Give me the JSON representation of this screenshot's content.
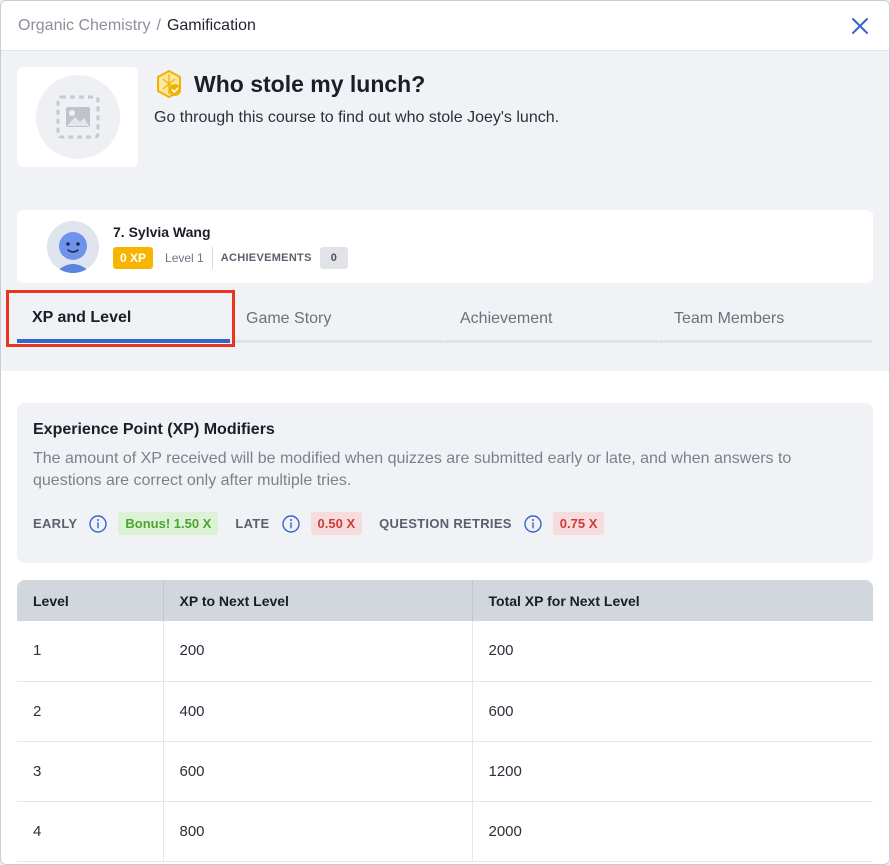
{
  "breadcrumb": {
    "parent": "Organic Chemistry",
    "separator": "/",
    "current": "Gamification"
  },
  "course": {
    "title": "Who stole my lunch?",
    "description": "Go through this course to find out who stole Joey's lunch."
  },
  "profile": {
    "name": "7. Sylvia Wang",
    "xp": "0 XP",
    "level": "Level 1",
    "achievements_label": "ACHIEVEMENTS",
    "achievements_count": "0"
  },
  "tabs": [
    {
      "label": "XP and Level",
      "active": true
    },
    {
      "label": "Game Story",
      "active": false
    },
    {
      "label": "Achievement",
      "active": false
    },
    {
      "label": "Team Members",
      "active": false
    }
  ],
  "modifiers": {
    "title": "Experience Point (XP) Modifiers",
    "description": "The amount of XP received will be modified when quizzes are submitted early or late, and when answers to questions are correct only after multiple tries.",
    "early_label": "EARLY",
    "early_value": "Bonus! 1.50 X",
    "late_label": "LATE",
    "late_value": "0.50 X",
    "retries_label": "QUESTION RETRIES",
    "retries_value": "0.75 X"
  },
  "level_table": {
    "headers": [
      "Level",
      "XP to Next Level",
      "Total XP for Next Level"
    ],
    "rows": [
      [
        "1",
        "200",
        "200"
      ],
      [
        "2",
        "400",
        "600"
      ],
      [
        "3",
        "600",
        "1200"
      ],
      [
        "4",
        "800",
        "2000"
      ]
    ]
  },
  "colors": {
    "accent": "#3467c9",
    "xp_badge": "#f7b500",
    "highlight": "#e8361e",
    "bonus_green": "#4ba52e",
    "penalty_red": "#d23a3a"
  },
  "icons": {
    "close": "close-icon",
    "course_badge": "achievement-badge-icon",
    "image_placeholder": "image-placeholder-icon",
    "info": "info-icon"
  }
}
